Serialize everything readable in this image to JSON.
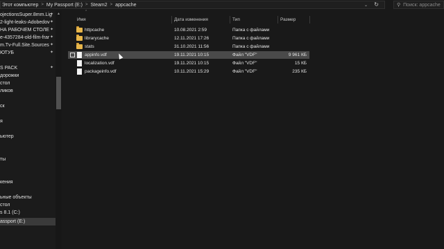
{
  "address": {
    "crumbs": [
      "Этот компьютер",
      "My Passport (E:)",
      "Steam2",
      "appcache"
    ],
    "separator": ">"
  },
  "search": {
    "placeholder": "Поиск: appcache"
  },
  "nav": {
    "items": [
      {
        "label": "ojectionsSuper.8mm.Lig",
        "pinned": true
      },
      {
        "label": "2-light-leaks-Adobedov",
        "pinned": true
      },
      {
        "label": "НА РАБОЧЕМ СТОЛЕ",
        "pinned": true
      },
      {
        "label": "e-4357284-old-film-frar",
        "pinned": true
      },
      {
        "label": "m.Tv-Full.Site.Sources",
        "pinned": true
      },
      {
        "label": "ЮТУБ",
        "pinned": true
      },
      {
        "label": "",
        "pinned": false
      },
      {
        "label": "S PACK",
        "pinned": true
      },
      {
        "label": "дорожки",
        "pinned": false
      },
      {
        "label": "стол",
        "pinned": false
      },
      {
        "label": "ликов",
        "pinned": false
      },
      {
        "label": "",
        "pinned": false
      },
      {
        "label": "ск",
        "pinned": false
      },
      {
        "label": "",
        "pinned": false
      },
      {
        "label": "я",
        "pinned": false
      },
      {
        "label": "",
        "pinned": false
      },
      {
        "label": "ьютер",
        "pinned": false
      },
      {
        "label": "",
        "pinned": false
      },
      {
        "label": "",
        "pinned": false
      },
      {
        "label": "ты",
        "pinned": false
      },
      {
        "label": "",
        "pinned": false
      },
      {
        "label": "",
        "pinned": false
      },
      {
        "label": "кения",
        "pinned": false
      },
      {
        "label": "",
        "pinned": false
      },
      {
        "label": "ьные объекты",
        "pinned": false
      },
      {
        "label": "стол",
        "pinned": false
      },
      {
        "label": "s 8.1 (C:)",
        "pinned": false
      },
      {
        "label": "assport (E:)",
        "pinned": false
      }
    ]
  },
  "columns": {
    "name": "Имя",
    "date": "Дата изменения",
    "type": "Тип",
    "size": "Размер"
  },
  "files": [
    {
      "name": "httpcache",
      "date": "10.08.2021 2:59",
      "type": "Папка с файлами",
      "size": "",
      "kind": "folder"
    },
    {
      "name": "librarycache",
      "date": "12.11.2021 17:26",
      "type": "Папка с файлами",
      "size": "",
      "kind": "folder"
    },
    {
      "name": "stats",
      "date": "31.10.2021 11:56",
      "type": "Папка с файлами",
      "size": "",
      "kind": "folder"
    },
    {
      "name": "appinfo.vdf",
      "date": "19.11.2021 10:15",
      "type": "Файл \"VDF\"",
      "size": "9 961 КБ",
      "kind": "file"
    },
    {
      "name": "localization.vdf",
      "date": "19.11.2021 10:15",
      "type": "Файл \"VDF\"",
      "size": "15 КБ",
      "kind": "file"
    },
    {
      "name": "packageinfo.vdf",
      "date": "10.11.2021 15:29",
      "type": "Файл \"VDF\"",
      "size": "235 КБ",
      "kind": "file"
    }
  ],
  "colors": {
    "background": "#191919",
    "folder": "#e8b64a",
    "hover_row": "#4a4a4a",
    "selected_nav": "#3a3a3a"
  }
}
